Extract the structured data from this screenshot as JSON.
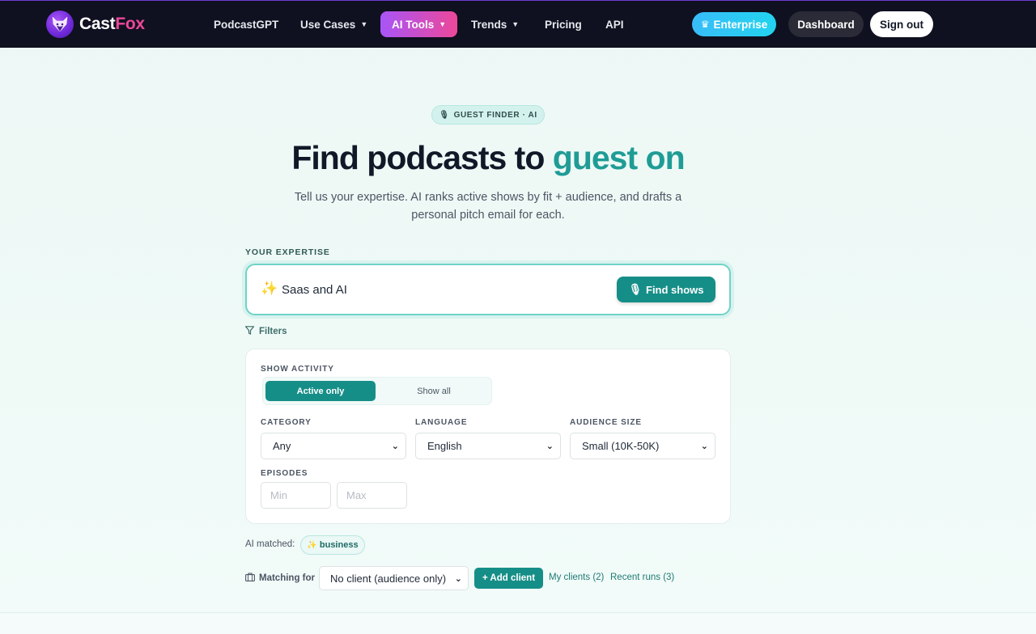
{
  "brand": {
    "name_main": "Cast",
    "name_accent": "Fox"
  },
  "nav": [
    {
      "label": "PodcastGPT",
      "dropdown": false,
      "active": false
    },
    {
      "label": "Use Cases",
      "dropdown": true,
      "active": false
    },
    {
      "label": "AI Tools",
      "dropdown": true,
      "active": true
    },
    {
      "label": "Trends",
      "dropdown": true,
      "active": false
    },
    {
      "label": "Pricing",
      "dropdown": false,
      "active": false
    },
    {
      "label": "API",
      "dropdown": false,
      "active": false
    }
  ],
  "header_actions": {
    "enterprise": "Enterprise",
    "dashboard": "Dashboard",
    "sign_out": "Sign out"
  },
  "hero": {
    "badge": "GUEST FINDER · AI",
    "title_main": "Find podcasts to ",
    "title_accent": "guest on",
    "subtitle": "Tell us your expertise. AI ranks active shows by fit + audience, and drafts a personal pitch email for each."
  },
  "expertise": {
    "label": "YOUR EXPERTISE",
    "value": "Saas and AI",
    "button": "Find shows"
  },
  "filters": {
    "toggle_label": "Filters",
    "show_activity": {
      "label": "SHOW ACTIVITY",
      "options": [
        "Active only",
        "Show all"
      ],
      "selected": "Active only"
    },
    "category": {
      "label": "CATEGORY",
      "value": "Any"
    },
    "language": {
      "label": "LANGUAGE",
      "value": "English"
    },
    "audience_size": {
      "label": "AUDIENCE SIZE",
      "value": "Small (10K-50K)"
    },
    "episodes": {
      "label": "EPISODES",
      "min_placeholder": "Min",
      "max_placeholder": "Max"
    }
  },
  "ai_matched": {
    "label": "AI matched:",
    "tags": [
      "business"
    ]
  },
  "matching": {
    "label": "Matching for",
    "client_value": "No client (audience only)",
    "add_client": "+ Add client",
    "my_clients": "My clients (2)",
    "recent_runs": "Recent runs (3)"
  },
  "colors": {
    "accent_teal": "#168e88",
    "brand_purple": "#a855f7",
    "brand_pink": "#ec4899",
    "nav_bg": "#0f1020",
    "enterprise_cyan": "#38bdf8"
  },
  "icons": [
    "fox-logo-icon",
    "chevron-down-icon",
    "crown-icon",
    "microphone-icon",
    "sparkle-icon",
    "funnel-icon",
    "briefcase-icon"
  ]
}
